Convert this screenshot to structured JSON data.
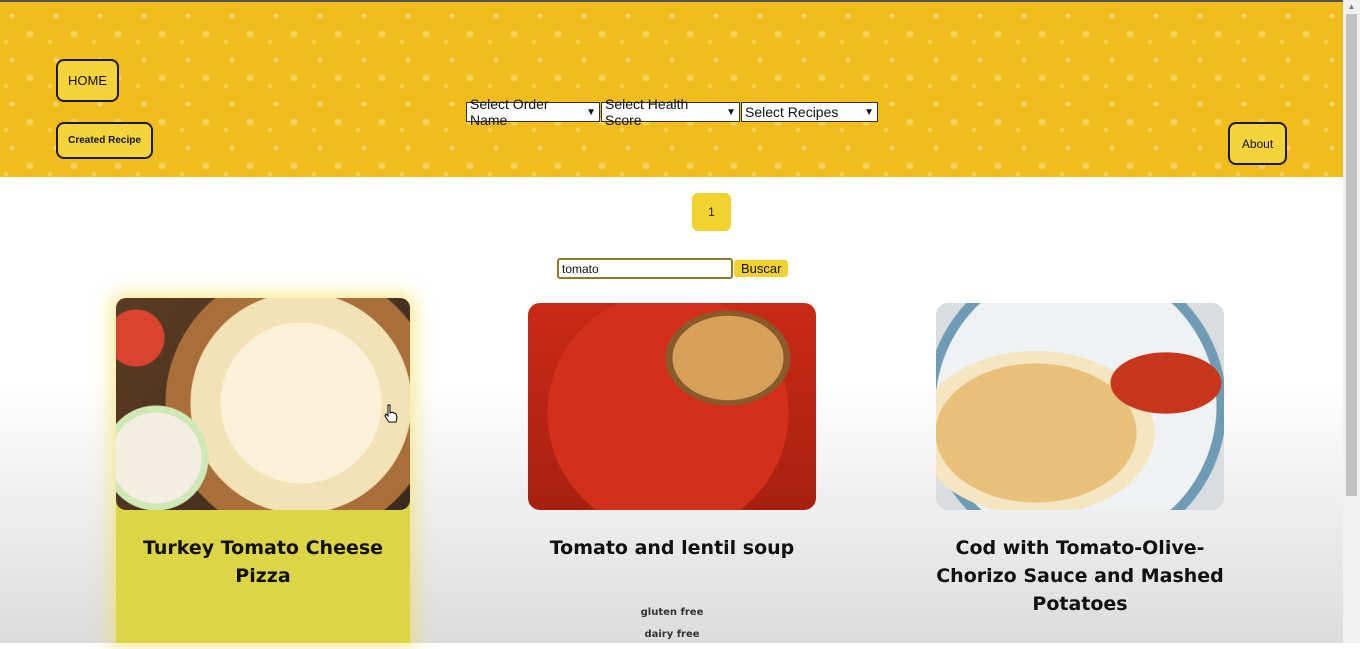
{
  "header": {
    "home_label": "HOME",
    "created_recipe_label": "Created Recipe",
    "about_label": "About",
    "filters": {
      "order": "Select Order Name",
      "health": "Select Health Score",
      "recipes": "Select Recipes"
    }
  },
  "pagination": {
    "pages": [
      "1"
    ]
  },
  "search": {
    "value": "tomato",
    "button_label": "Buscar"
  },
  "cards": [
    {
      "title": "Turkey Tomato Cheese Pizza",
      "diets": []
    },
    {
      "title": "Tomato and lentil soup",
      "diets": [
        "gluten free",
        "dairy free"
      ]
    },
    {
      "title": "Cod with Tomato-Olive-Chorizo Sauce and Mashed Potatoes",
      "diets": []
    }
  ],
  "colors": {
    "brand_yellow": "#f0bd1c",
    "button_yellow": "#f5d33a",
    "card_highlight": "#dcd545"
  },
  "icons": {
    "cursor": "hand-pointer-icon",
    "dropdown": "chevron-down-icon"
  }
}
